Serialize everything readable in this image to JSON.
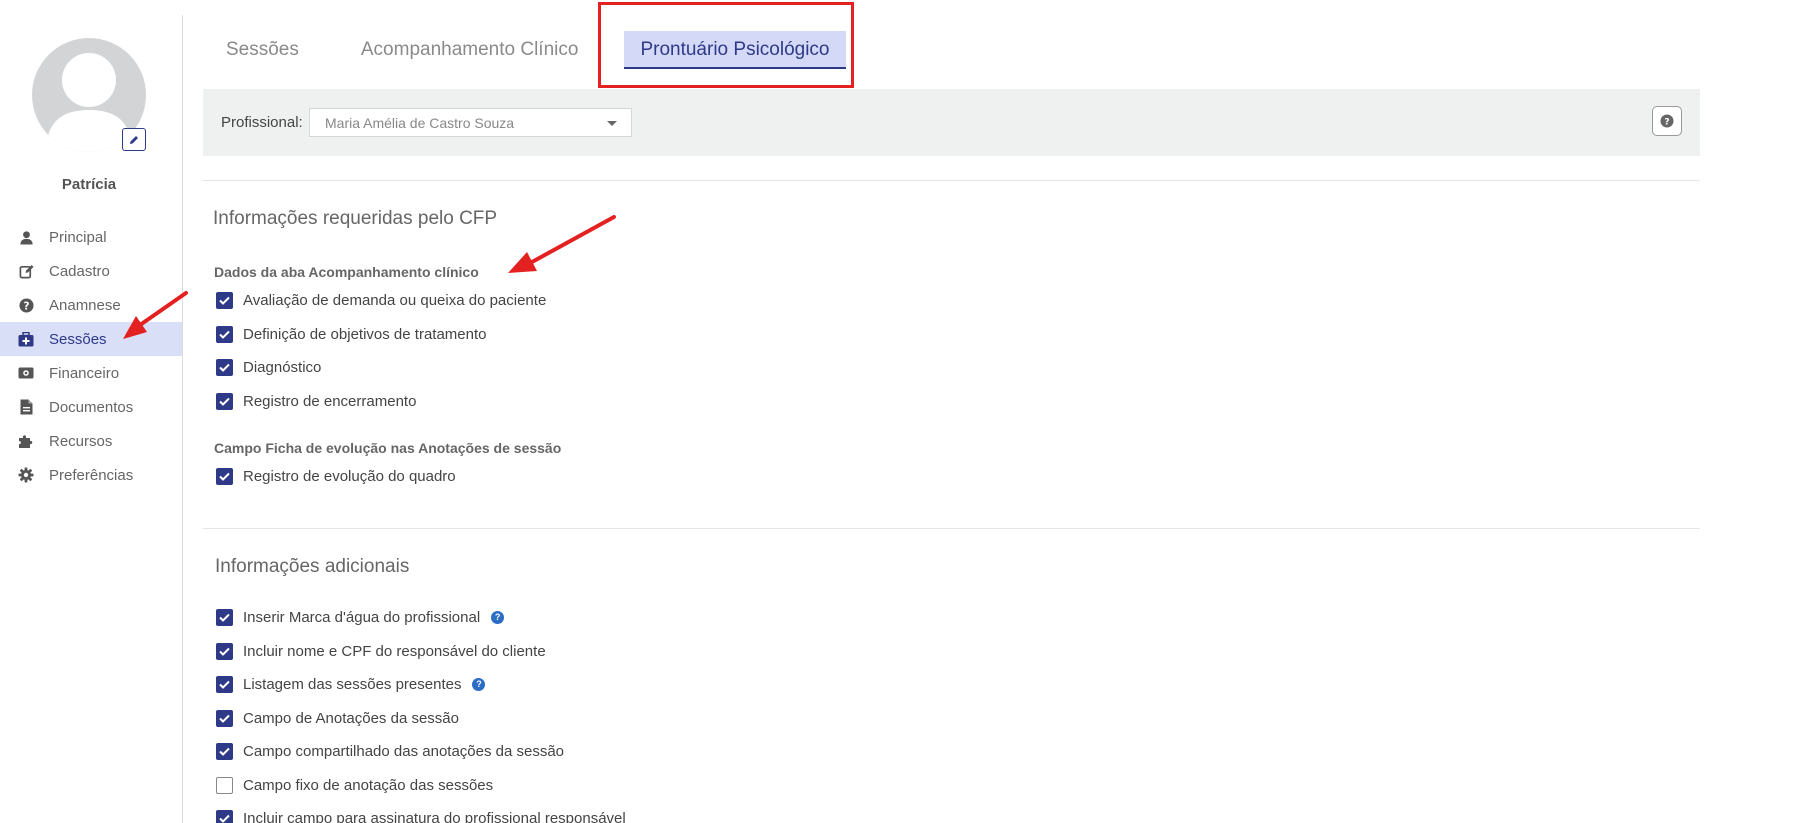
{
  "user": {
    "name": "Patrícia"
  },
  "sidebar": {
    "items": [
      {
        "label": "Principal",
        "icon": "user-icon",
        "active": false
      },
      {
        "label": "Cadastro",
        "icon": "edit-icon",
        "active": false
      },
      {
        "label": "Anamnese",
        "icon": "question-circle-icon",
        "active": false
      },
      {
        "label": "Sessões",
        "icon": "briefcase-medical-icon",
        "active": true
      },
      {
        "label": "Financeiro",
        "icon": "money-bill-icon",
        "active": false
      },
      {
        "label": "Documentos",
        "icon": "file-icon",
        "active": false
      },
      {
        "label": "Recursos",
        "icon": "puzzle-piece-icon",
        "active": false
      },
      {
        "label": "Preferências",
        "icon": "gear-icon",
        "active": false
      }
    ]
  },
  "tabs": [
    {
      "label": "Sessões",
      "active": false
    },
    {
      "label": "Acompanhamento Clínico",
      "active": false
    },
    {
      "label": "Prontuário Psicológico",
      "active": true
    }
  ],
  "filter": {
    "label": "Profissional:",
    "selected": "Maria Amélia de Castro Souza"
  },
  "cfp_section": {
    "title": "Informações requeridas pelo CFP",
    "groups": [
      {
        "title": "Dados da aba Acompanhamento clínico",
        "items": [
          {
            "label": "Avaliação de demanda ou queixa do paciente",
            "checked": true
          },
          {
            "label": "Definição de objetivos de tratamento",
            "checked": true
          },
          {
            "label": "Diagnóstico",
            "checked": true
          },
          {
            "label": "Registro de encerramento",
            "checked": true
          }
        ]
      },
      {
        "title": "Campo Ficha de evolução nas Anotações de sessão",
        "items": [
          {
            "label": "Registro de evolução do quadro",
            "checked": true
          }
        ]
      }
    ]
  },
  "additional_section": {
    "title": "Informações adicionais",
    "items": [
      {
        "label": "Inserir Marca d'água do profissional",
        "checked": true,
        "info": true
      },
      {
        "label": "Incluir nome e CPF do responsável do cliente",
        "checked": true,
        "info": false
      },
      {
        "label": "Listagem das sessões presentes",
        "checked": true,
        "info": true
      },
      {
        "label": "Campo de Anotações da sessão",
        "checked": true,
        "info": false
      },
      {
        "label": "Campo compartilhado das anotações da sessão",
        "checked": true,
        "info": false
      },
      {
        "label": "Campo fixo de anotação das sessões",
        "checked": false,
        "info": false
      },
      {
        "label": "Incluir campo para assinatura do profissional responsável",
        "checked": true,
        "info": false
      }
    ]
  },
  "colors": {
    "accent": "#2e3a87",
    "active_bg": "#dadff8",
    "annotation": "#e32121",
    "info": "#2b6cc4"
  }
}
